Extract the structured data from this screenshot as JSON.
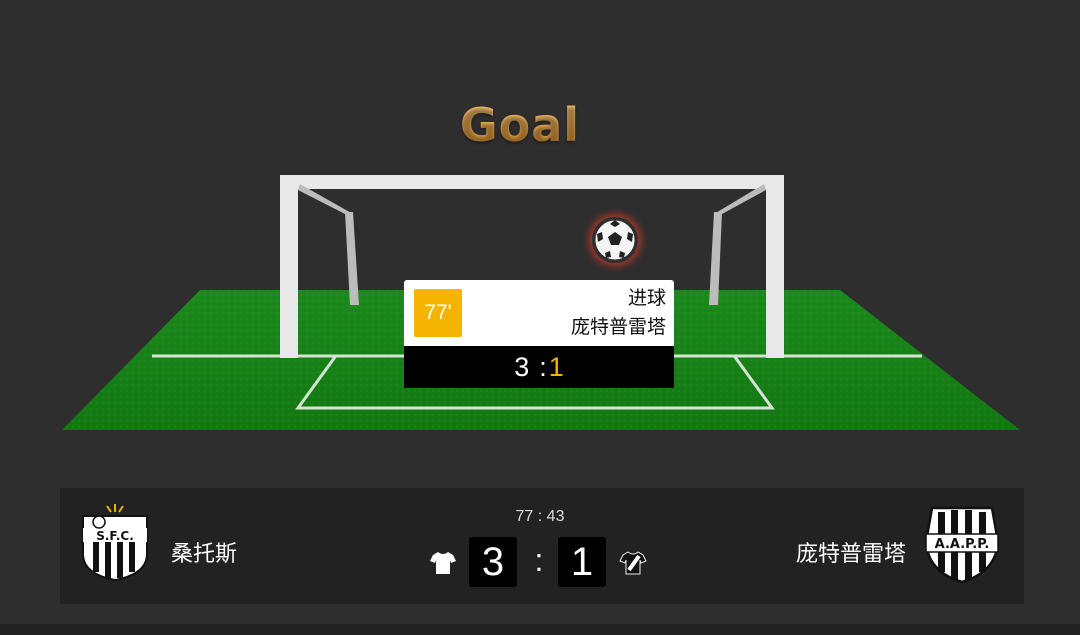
{
  "headline": "Goal",
  "event": {
    "minute": "77'",
    "type": "进球",
    "team": "庞特普雷塔",
    "score_home": "3",
    "score_separator": ":",
    "score_away": "1"
  },
  "scoreboard": {
    "clock": "77 : 43",
    "home": {
      "name": "桑托斯",
      "score": "3",
      "logo_text": "S.F.C.",
      "shirt_icon": "white-shirt-icon"
    },
    "separator": ":",
    "away": {
      "name": "庞特普雷塔",
      "score": "1",
      "logo_text": "A.A.P.P.",
      "shirt_icon": "black-white-shirt-icon"
    }
  },
  "colors": {
    "background": "#2e2e2e",
    "headline": "#e8a646",
    "minute_badge": "#f5b400",
    "pitch": "#1d8a1d"
  }
}
